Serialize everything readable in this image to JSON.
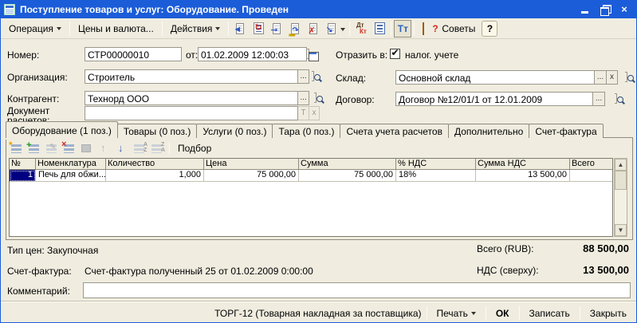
{
  "window": {
    "title": "Поступление товаров и услуг: Оборудование. Проведен"
  },
  "toolbar": {
    "operation_label": "Операция",
    "prices_label": "Цены и валюта...",
    "actions_label": "Действия",
    "dt": "Дт",
    "kt": "Кт",
    "tt": "Тт",
    "advice_label": "Советы",
    "help_label": "?"
  },
  "fields": {
    "number_label": "Номер:",
    "number_value": "СТР00000010",
    "date_label": "от:",
    "date_value": "01.02.2009 12:00:03",
    "organization_label": "Организация:",
    "organization_value": "Строитель",
    "contractor_label": "Контрагент:",
    "contractor_value": "Технорд ООО",
    "settlement_doc_label_1": "Документ",
    "settlement_doc_label_2": "расчетов:",
    "settlement_doc_value": "",
    "settlement_doc_t": "Т",
    "settlement_doc_x": "x",
    "reflect_label": "Отразить в:",
    "reflect_option": "налог. учете",
    "warehouse_label": "Склад:",
    "warehouse_value": "Основной склад",
    "warehouse_x": "x",
    "contract_label": "Договор:",
    "contract_value": "Договор №12/01/1 от 12.01.2009",
    "ellipsis": "..."
  },
  "tabs": [
    {
      "label": "Оборудование (1 поз.)",
      "active": true
    },
    {
      "label": "Товары (0 поз.)"
    },
    {
      "label": "Услуги (0 поз.)"
    },
    {
      "label": "Тара (0 поз.)"
    },
    {
      "label": "Счета учета расчетов"
    },
    {
      "label": "Дополнительно"
    },
    {
      "label": "Счет-фактура"
    }
  ],
  "grid_toolbar": {
    "pick_label": "Подбор"
  },
  "table": {
    "columns": [
      "№",
      "Номенклатура",
      "Количество",
      "Цена",
      "Сумма",
      "% НДС",
      "Сумма НДС",
      "Всего"
    ],
    "rows": [
      [
        "1",
        "Печь для обжи...",
        "1,000",
        "75 000,00",
        "75 000,00",
        "18%",
        "13 500,00",
        ""
      ]
    ]
  },
  "totals": {
    "price_type": "Тип цен: Закупочная",
    "invoice_label": "Счет-фактура:",
    "invoice_value": "Счет-фактура полученный 25 от 01.02.2009 0:00:00",
    "comment_label": "Комментарий:",
    "comment_value": "",
    "total_label": "Всего (RUB):",
    "total_value": "88 500,00",
    "vat_label": "НДС (сверху):",
    "vat_value": "13 500,00"
  },
  "footer": {
    "torg_label": "ТОРГ-12 (Товарная накладная за поставщика)",
    "print_label": "Печать",
    "ok_label": "ОК",
    "save_label": "Записать",
    "close_label": "Закрыть"
  },
  "colors": {
    "titlebar": "#1b5cd8",
    "background": "#f0ede0",
    "selection": "#000080"
  }
}
